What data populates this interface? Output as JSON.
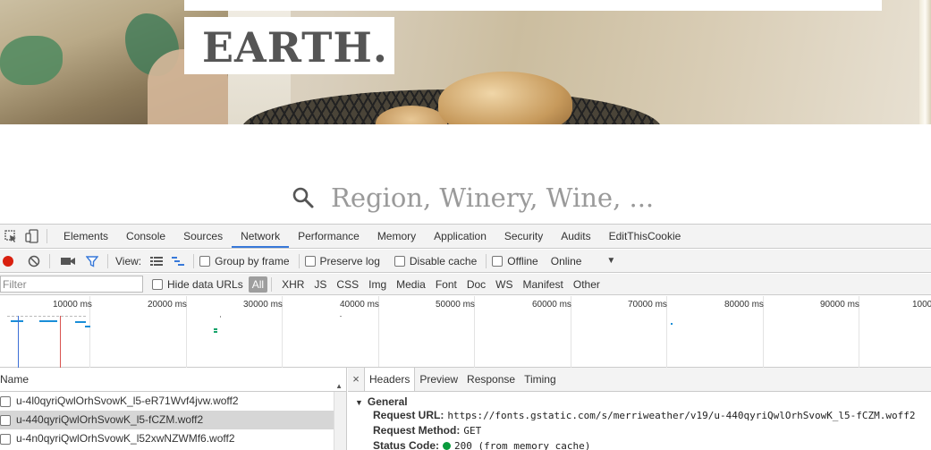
{
  "site": {
    "logo": "EARTH.",
    "search_placeholder": "Region, Winery, Wine, ..."
  },
  "devtools": {
    "tabs": [
      "Elements",
      "Console",
      "Sources",
      "Network",
      "Performance",
      "Memory",
      "Application",
      "Security",
      "Audits",
      "EditThisCookie"
    ],
    "active_tab": "Network",
    "controls": {
      "view_label": "View:",
      "group_by_frame": "Group by frame",
      "preserve_log": "Preserve log",
      "disable_cache": "Disable cache",
      "offline": "Offline",
      "throttling": "Online"
    },
    "filter": {
      "placeholder": "Filter",
      "hide_data_urls": "Hide data URLs",
      "types": [
        "All",
        "XHR",
        "JS",
        "CSS",
        "Img",
        "Media",
        "Font",
        "Doc",
        "WS",
        "Manifest",
        "Other"
      ],
      "active_type": "All"
    },
    "timeline_ticks": [
      "10000 ms",
      "20000 ms",
      "30000 ms",
      "40000 ms",
      "50000 ms",
      "60000 ms",
      "70000 ms",
      "80000 ms",
      "90000 ms",
      "1000"
    ],
    "request_list": {
      "column_name": "Name",
      "rows": [
        {
          "name": "u-4l0qyriQwlOrhSvowK_l5-eR71Wvf4jvw.woff2",
          "selected": false
        },
        {
          "name": "u-440qyriQwlOrhSvowK_l5-fCZM.woff2",
          "selected": true
        },
        {
          "name": "u-4n0qyriQwlOrhSvowK_l52xwNZWMf6.woff2",
          "selected": false
        }
      ]
    },
    "detail": {
      "close": "×",
      "tabs": [
        "Headers",
        "Preview",
        "Response",
        "Timing"
      ],
      "active_tab": "Headers",
      "section": "General",
      "headers": [
        {
          "key": "Request URL:",
          "value": "https://fonts.gstatic.com/s/merriweather/v19/u-440qyriQwlOrhSvowK_l5-fCZM.woff2"
        },
        {
          "key": "Request Method:",
          "value": "GET"
        },
        {
          "key": "Status Code:",
          "value": "200  (from memory cache)"
        }
      ]
    },
    "colors": {
      "accent": "#3879d9",
      "record": "#d9200f",
      "status_ok": "#0a9b3d"
    }
  }
}
